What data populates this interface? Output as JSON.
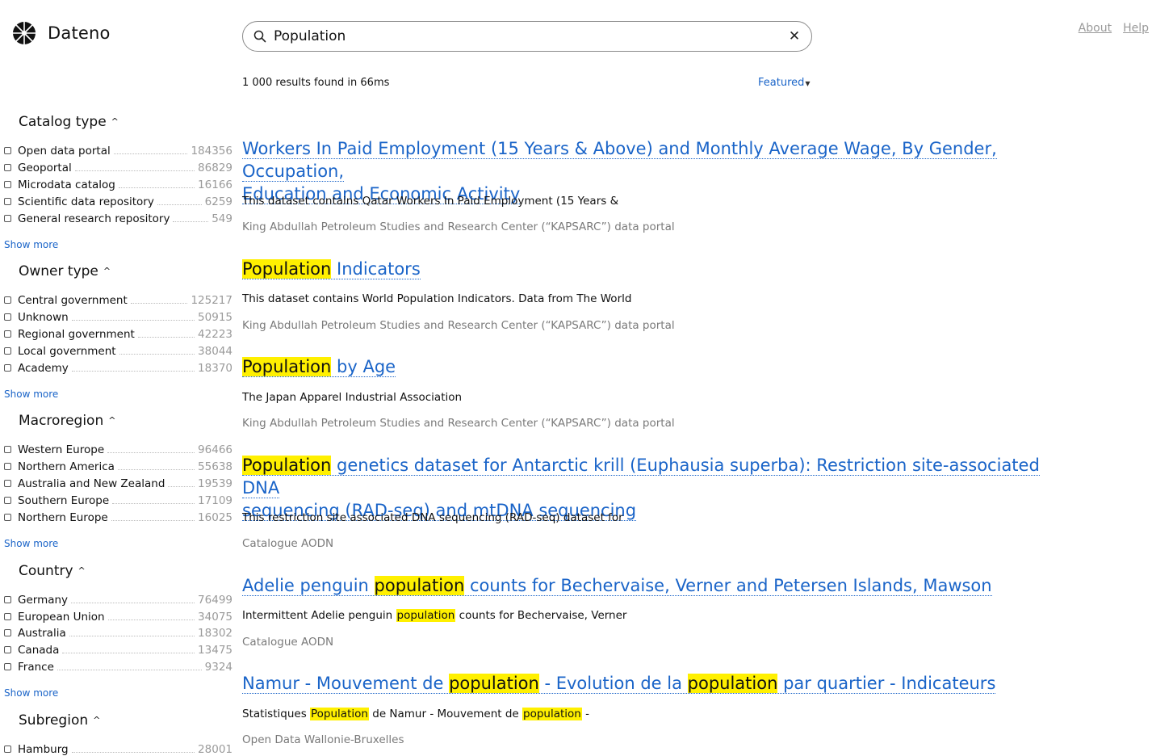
{
  "app": {
    "name": "Dateno"
  },
  "search": {
    "value": "Population",
    "clear_icon": "close-icon"
  },
  "nav": {
    "about": "About",
    "help": "Help"
  },
  "results_summary": "1 000 results found in 66ms",
  "sort": {
    "label": "Featured"
  },
  "facets": [
    {
      "title": "Catalog type",
      "items": [
        {
          "label": "Open data portal",
          "count": "184356"
        },
        {
          "label": "Geoportal",
          "count": "86829"
        },
        {
          "label": "Microdata catalog",
          "count": "16166"
        },
        {
          "label": "Scientific data repository",
          "count": "6259"
        },
        {
          "label": "General research repository",
          "count": "549"
        }
      ],
      "show_more": "Show more"
    },
    {
      "title": "Owner type",
      "items": [
        {
          "label": "Central government",
          "count": "125217"
        },
        {
          "label": "Unknown",
          "count": "50915"
        },
        {
          "label": "Regional government",
          "count": "42223"
        },
        {
          "label": "Local government",
          "count": "38044"
        },
        {
          "label": "Academy",
          "count": "18370"
        }
      ],
      "show_more": "Show more"
    },
    {
      "title": "Macroregion",
      "items": [
        {
          "label": "Western Europe",
          "count": "96466"
        },
        {
          "label": "Northern America",
          "count": "55638"
        },
        {
          "label": "Australia and New Zealand",
          "count": "19539"
        },
        {
          "label": "Southern Europe",
          "count": "17109"
        },
        {
          "label": "Northern Europe",
          "count": "16025"
        }
      ],
      "show_more": "Show more"
    },
    {
      "title": "Country",
      "items": [
        {
          "label": "Germany",
          "count": "76499"
        },
        {
          "label": "European Union",
          "count": "34075"
        },
        {
          "label": "Australia",
          "count": "18302"
        },
        {
          "label": "Canada",
          "count": "13475"
        },
        {
          "label": "France",
          "count": "9324"
        }
      ],
      "show_more": "Show more"
    },
    {
      "title": "Subregion",
      "items": [
        {
          "label": "Hamburg",
          "count": "28001"
        }
      ]
    }
  ],
  "results": [
    {
      "title_line1": "Workers In Paid Employment (15 Years & Above) and Monthly Average Wage, By Gender, Occupation,",
      "title_line2": "Education and Economic Activity",
      "description": "This dataset contains Qatar Workers In Paid Employment (15 Years &",
      "source": "King Abdullah Petroleum Studies and Research Center (“KAPSARC”) data portal"
    },
    {
      "title_hl": "Population",
      "title_rest": " Indicators",
      "description": "This dataset contains World Population Indicators. Data from The World",
      "source": "King Abdullah Petroleum Studies and Research Center (“KAPSARC”) data portal"
    },
    {
      "title_hl": "Population",
      "title_rest": " by Age",
      "description": "The Japan Apparel Industrial Association",
      "source": "King Abdullah Petroleum Studies and Research Center (“KAPSARC”) data portal"
    },
    {
      "title_hl": "Population",
      "title_rest": " genetics dataset for Antarctic krill (Euphausia superba): Restriction site-associated DNA",
      "title_line2": "sequencing (RAD-seq) and mtDNA sequencing",
      "description": "This restriction site associated DNA sequencing (RAD-seq) dataset for",
      "source": "Catalogue AODN"
    },
    {
      "title_pre": "Adelie penguin ",
      "title_hl": "population",
      "title_rest": " counts for Bechervaise, Verner and Petersen Islands, Mawson",
      "desc_pre": "Intermittent Adelie penguin ",
      "desc_hl": "population",
      "desc_rest": " counts for Bechervaise, Verner",
      "source": "Catalogue AODN"
    },
    {
      "title_pre": "Namur - Mouvement de ",
      "title_hl": "population",
      "title_mid": " - Evolution de la ",
      "title_hl2": "population",
      "title_rest": " par quartier - Indicateurs",
      "desc_pre": "Statistiques ",
      "desc_hl": "Population",
      "desc_mid": " de Namur - Mouvement de ",
      "desc_hl2": "population",
      "desc_rest": " -",
      "source": "Open Data Wallonie-Bruxelles"
    }
  ]
}
